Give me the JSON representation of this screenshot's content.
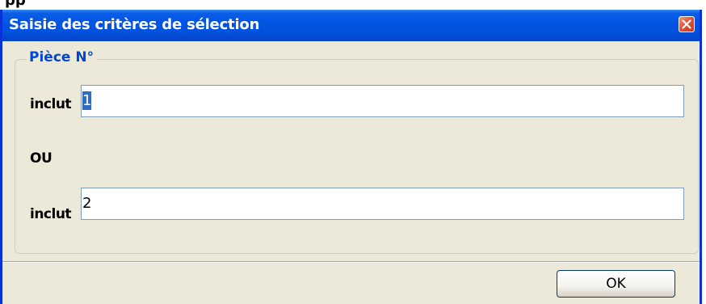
{
  "window": {
    "title": "Saisie des critères de sélection",
    "close_icon": "close-icon"
  },
  "group": {
    "legend": "Pièce N°"
  },
  "criteria": {
    "first": {
      "label": "inclut",
      "value": "1",
      "value_selected": true
    },
    "operator": "OU",
    "second": {
      "label": "inclut",
      "value": "2"
    }
  },
  "buttons": {
    "ok_label": "OK"
  },
  "colors": {
    "titlebar": "#0254e3",
    "window_border": "#0831d9",
    "dialog_bg": "#ece9d8",
    "legend_text": "#0046d5",
    "selection": "#316ac5",
    "close_button": "#e0533b"
  }
}
